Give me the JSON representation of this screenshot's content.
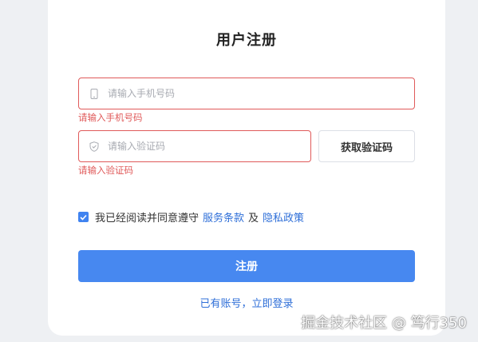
{
  "form": {
    "title": "用户注册",
    "phone": {
      "placeholder": "请输入手机号码",
      "value": "",
      "error": "请输入手机号码",
      "icon": "phone-icon"
    },
    "code": {
      "placeholder": "请输入验证码",
      "value": "",
      "error": "请输入验证码",
      "icon": "shield-icon",
      "button_label": "获取验证码"
    },
    "agreement": {
      "checked": true,
      "prefix": "我已经阅读并同意遵守",
      "terms_link": "服务条款",
      "and": "及",
      "privacy_link": "隐私政策"
    },
    "submit_label": "注册",
    "login_link": "已有账号，立即登录"
  },
  "watermark": "掘金技术社区 @ 笃行350",
  "colors": {
    "accent": "#4788f0",
    "link": "#2f6fd8",
    "error": "#e05a5a",
    "background": "#eef0f3"
  }
}
